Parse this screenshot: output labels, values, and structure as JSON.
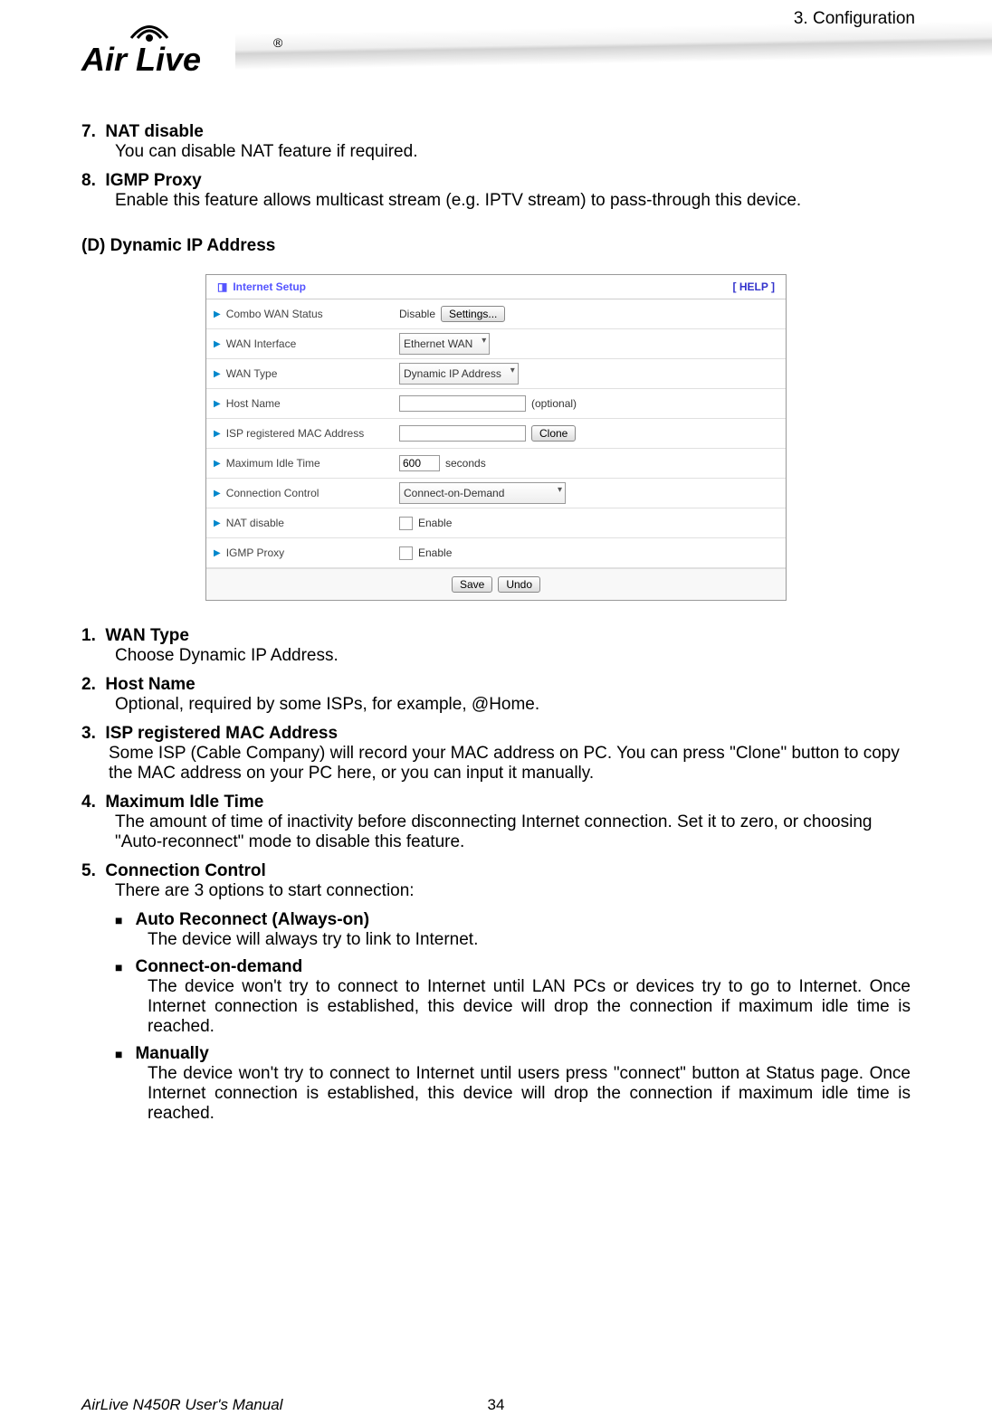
{
  "header": {
    "chapter": "3.  Configuration",
    "brand": "Air Live",
    "reg": "®"
  },
  "items_top": [
    {
      "num": "7.",
      "title": "NAT disable",
      "body": "You can disable NAT feature if required."
    },
    {
      "num": "8.",
      "title": "IGMP Proxy",
      "body": "Enable this feature allows multicast stream (e.g. IPTV stream) to pass-through this device."
    }
  ],
  "section_d": "(D)   Dynamic IP Address",
  "screenshot": {
    "panel_title": "Internet Setup",
    "help": "[ HELP ]",
    "rows": {
      "combo_wan_status": {
        "label": "Combo WAN Status",
        "text": "Disable",
        "btn": "Settings..."
      },
      "wan_interface": {
        "label": "WAN Interface",
        "value": "Ethernet WAN"
      },
      "wan_type": {
        "label": "WAN Type",
        "value": "Dynamic IP Address"
      },
      "host_name": {
        "label": "Host Name",
        "suffix": "(optional)"
      },
      "isp_mac": {
        "label": "ISP registered MAC Address",
        "btn": "Clone"
      },
      "max_idle": {
        "label": "Maximum Idle Time",
        "value": "600",
        "suffix": "seconds"
      },
      "conn_ctrl": {
        "label": "Connection Control",
        "value": "Connect-on-Demand"
      },
      "nat_disable": {
        "label": "NAT disable",
        "text": "Enable"
      },
      "igmp_proxy": {
        "label": "IGMP Proxy",
        "text": "Enable"
      }
    },
    "save": "Save",
    "undo": "Undo"
  },
  "items_bottom": [
    {
      "num": "1.",
      "title": "WAN Type",
      "body": "Choose Dynamic IP Address."
    },
    {
      "num": "2.",
      "title": "Host Name",
      "body": "Optional, required by some ISPs, for example, @Home."
    },
    {
      "num": "3.",
      "title": "ISP registered MAC Address",
      "body": "Some ISP (Cable Company) will record your MAC address on PC. You can press \"Clone\" button to copy the MAC address on your PC here, or you can input it manually."
    },
    {
      "num": "4.",
      "title": "Maximum Idle Time",
      "body": "The amount of time of inactivity before disconnecting Internet connection. Set it to zero, or choosing \"Auto-reconnect\" mode to disable this feature."
    },
    {
      "num": "5.",
      "title": "Connection Control",
      "body": "There are 3 options to start connection:"
    }
  ],
  "sub_items": [
    {
      "title": "Auto Reconnect (Always-on)",
      "body": "The device will always try to link to Internet."
    },
    {
      "title": "Connect-on-demand",
      "body": "The device won't try to connect to Internet until LAN PCs or devices try to go to Internet. Once Internet connection is established, this device will drop the connection if maximum idle time is reached."
    },
    {
      "title": "Manually",
      "body": "The device won't try to connect to Internet until users press \"connect\" button at Status page. Once Internet connection is established, this device will drop the connection if maximum idle time is reached."
    }
  ],
  "footer": {
    "manual": "AirLive N450R User's Manual",
    "page": "34"
  }
}
